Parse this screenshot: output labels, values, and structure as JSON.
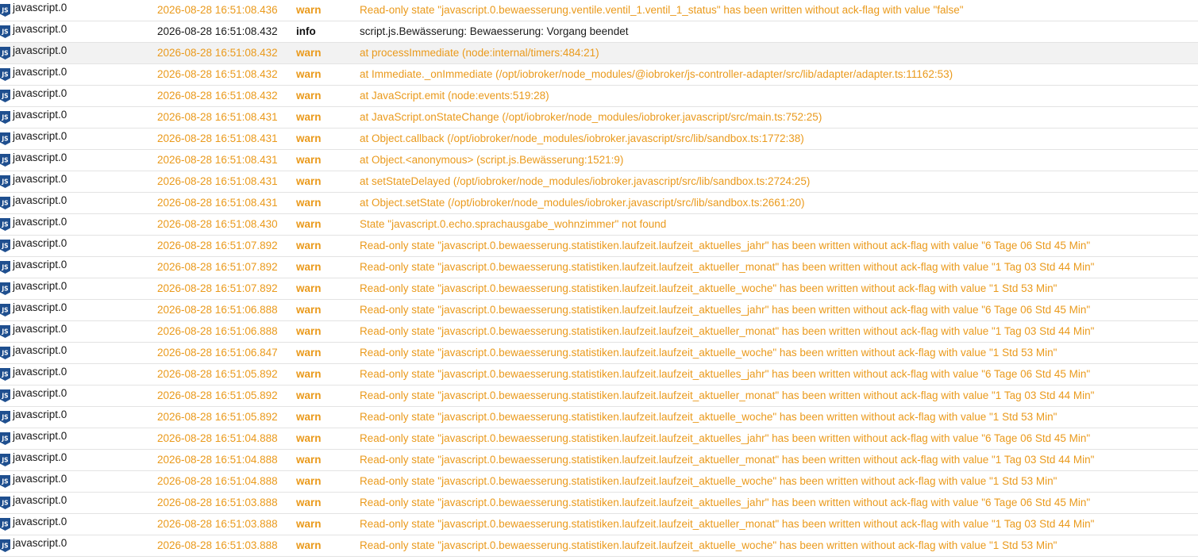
{
  "colors": {
    "warn": "#ea9a1c",
    "info": "#1a1a1a",
    "icon": "#1f4f8f",
    "selected_row": "#f2f2f2"
  },
  "icon": "javascript-adapter-icon",
  "rows": [
    {
      "source": "javascript.0",
      "time": "2026-08-28 16:51:08.436",
      "level": "warn",
      "message": "Read-only state \"javascript.0.bewaesserung.ventile.ventil_1.ventil_1_status\" has been written without ack-flag with value \"false\""
    },
    {
      "source": "javascript.0",
      "time": "2026-08-28 16:51:08.432",
      "level": "info",
      "message": "script.js.Bewässerung: Bewaesserung: Vorgang beendet"
    },
    {
      "source": "javascript.0",
      "time": "2026-08-28 16:51:08.432",
      "level": "warn",
      "message": "at processImmediate (node:internal/timers:484:21)"
    },
    {
      "source": "javascript.0",
      "time": "2026-08-28 16:51:08.432",
      "level": "warn",
      "message": "at Immediate._onImmediate (/opt/iobroker/node_modules/@iobroker/js-controller-adapter/src/lib/adapter/adapter.ts:11162:53)"
    },
    {
      "source": "javascript.0",
      "time": "2026-08-28 16:51:08.432",
      "level": "warn",
      "message": "at JavaScript.emit (node:events:519:28)"
    },
    {
      "source": "javascript.0",
      "time": "2026-08-28 16:51:08.431",
      "level": "warn",
      "message": "at JavaScript.onStateChange (/opt/iobroker/node_modules/iobroker.javascript/src/main.ts:752:25)"
    },
    {
      "source": "javascript.0",
      "time": "2026-08-28 16:51:08.431",
      "level": "warn",
      "message": "at Object.callback (/opt/iobroker/node_modules/iobroker.javascript/src/lib/sandbox.ts:1772:38)"
    },
    {
      "source": "javascript.0",
      "time": "2026-08-28 16:51:08.431",
      "level": "warn",
      "message": "at Object.<anonymous> (script.js.Bewässerung:1521:9)"
    },
    {
      "source": "javascript.0",
      "time": "2026-08-28 16:51:08.431",
      "level": "warn",
      "message": "at setStateDelayed (/opt/iobroker/node_modules/iobroker.javascript/src/lib/sandbox.ts:2724:25)"
    },
    {
      "source": "javascript.0",
      "time": "2026-08-28 16:51:08.431",
      "level": "warn",
      "message": "at Object.setState (/opt/iobroker/node_modules/iobroker.javascript/src/lib/sandbox.ts:2661:20)"
    },
    {
      "source": "javascript.0",
      "time": "2026-08-28 16:51:08.430",
      "level": "warn",
      "message": "State \"javascript.0.echo.sprachausgabe_wohnzimmer\" not found"
    },
    {
      "source": "javascript.0",
      "time": "2026-08-28 16:51:07.892",
      "level": "warn",
      "message": "Read-only state \"javascript.0.bewaesserung.statistiken.laufzeit.laufzeit_aktuelles_jahr\" has been written without ack-flag with value \"6 Tage 06 Std 45 Min\""
    },
    {
      "source": "javascript.0",
      "time": "2026-08-28 16:51:07.892",
      "level": "warn",
      "message": "Read-only state \"javascript.0.bewaesserung.statistiken.laufzeit.laufzeit_aktueller_monat\" has been written without ack-flag with value \"1 Tag 03 Std 44 Min\""
    },
    {
      "source": "javascript.0",
      "time": "2026-08-28 16:51:07.892",
      "level": "warn",
      "message": "Read-only state \"javascript.0.bewaesserung.statistiken.laufzeit.laufzeit_aktuelle_woche\" has been written without ack-flag with value \"1 Std 53 Min\""
    },
    {
      "source": "javascript.0",
      "time": "2026-08-28 16:51:06.888",
      "level": "warn",
      "message": "Read-only state \"javascript.0.bewaesserung.statistiken.laufzeit.laufzeit_aktuelles_jahr\" has been written without ack-flag with value \"6 Tage 06 Std 45 Min\""
    },
    {
      "source": "javascript.0",
      "time": "2026-08-28 16:51:06.888",
      "level": "warn",
      "message": "Read-only state \"javascript.0.bewaesserung.statistiken.laufzeit.laufzeit_aktueller_monat\" has been written without ack-flag with value \"1 Tag 03 Std 44 Min\""
    },
    {
      "source": "javascript.0",
      "time": "2026-08-28 16:51:06.847",
      "level": "warn",
      "message": "Read-only state \"javascript.0.bewaesserung.statistiken.laufzeit.laufzeit_aktuelle_woche\" has been written without ack-flag with value \"1 Std 53 Min\""
    },
    {
      "source": "javascript.0",
      "time": "2026-08-28 16:51:05.892",
      "level": "warn",
      "message": "Read-only state \"javascript.0.bewaesserung.statistiken.laufzeit.laufzeit_aktuelles_jahr\" has been written without ack-flag with value \"6 Tage 06 Std 45 Min\""
    },
    {
      "source": "javascript.0",
      "time": "2026-08-28 16:51:05.892",
      "level": "warn",
      "message": "Read-only state \"javascript.0.bewaesserung.statistiken.laufzeit.laufzeit_aktueller_monat\" has been written without ack-flag with value \"1 Tag 03 Std 44 Min\""
    },
    {
      "source": "javascript.0",
      "time": "2026-08-28 16:51:05.892",
      "level": "warn",
      "message": "Read-only state \"javascript.0.bewaesserung.statistiken.laufzeit.laufzeit_aktuelle_woche\" has been written without ack-flag with value \"1 Std 53 Min\""
    },
    {
      "source": "javascript.0",
      "time": "2026-08-28 16:51:04.888",
      "level": "warn",
      "message": "Read-only state \"javascript.0.bewaesserung.statistiken.laufzeit.laufzeit_aktuelles_jahr\" has been written without ack-flag with value \"6 Tage 06 Std 45 Min\""
    },
    {
      "source": "javascript.0",
      "time": "2026-08-28 16:51:04.888",
      "level": "warn",
      "message": "Read-only state \"javascript.0.bewaesserung.statistiken.laufzeit.laufzeit_aktueller_monat\" has been written without ack-flag with value \"1 Tag 03 Std 44 Min\""
    },
    {
      "source": "javascript.0",
      "time": "2026-08-28 16:51:04.888",
      "level": "warn",
      "message": "Read-only state \"javascript.0.bewaesserung.statistiken.laufzeit.laufzeit_aktuelle_woche\" has been written without ack-flag with value \"1 Std 53 Min\""
    },
    {
      "source": "javascript.0",
      "time": "2026-08-28 16:51:03.888",
      "level": "warn",
      "message": "Read-only state \"javascript.0.bewaesserung.statistiken.laufzeit.laufzeit_aktuelles_jahr\" has been written without ack-flag with value \"6 Tage 06 Std 45 Min\""
    },
    {
      "source": "javascript.0",
      "time": "2026-08-28 16:51:03.888",
      "level": "warn",
      "message": "Read-only state \"javascript.0.bewaesserung.statistiken.laufzeit.laufzeit_aktueller_monat\" has been written without ack-flag with value \"1 Tag 03 Std 44 Min\""
    },
    {
      "source": "javascript.0",
      "time": "2026-08-28 16:51:03.888",
      "level": "warn",
      "message": "Read-only state \"javascript.0.bewaesserung.statistiken.laufzeit.laufzeit_aktuelle_woche\" has been written without ack-flag with value \"1 Std 53 Min\""
    }
  ]
}
